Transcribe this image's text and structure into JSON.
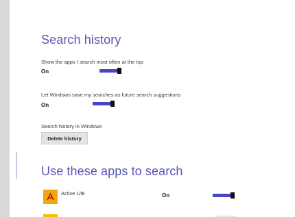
{
  "search_history": {
    "title": "Search history",
    "show_apps_label": "Show the apps I search most often at the top",
    "show_apps_value": "On",
    "save_searches_label": "Let Windows save my searches as future search suggestions",
    "save_searches_value": "On",
    "history_label": "Search history in Windows",
    "delete_button": "Delete history"
  },
  "apps_section": {
    "title": "Use these apps to search",
    "apps": [
      {
        "name": "Active Life",
        "value": "On",
        "icon": "acrobat-reader-icon"
      }
    ]
  },
  "colors": {
    "accent": "#5a56b9",
    "toggle_track": "#4a46c4",
    "app_icon": "#f2a60f"
  }
}
